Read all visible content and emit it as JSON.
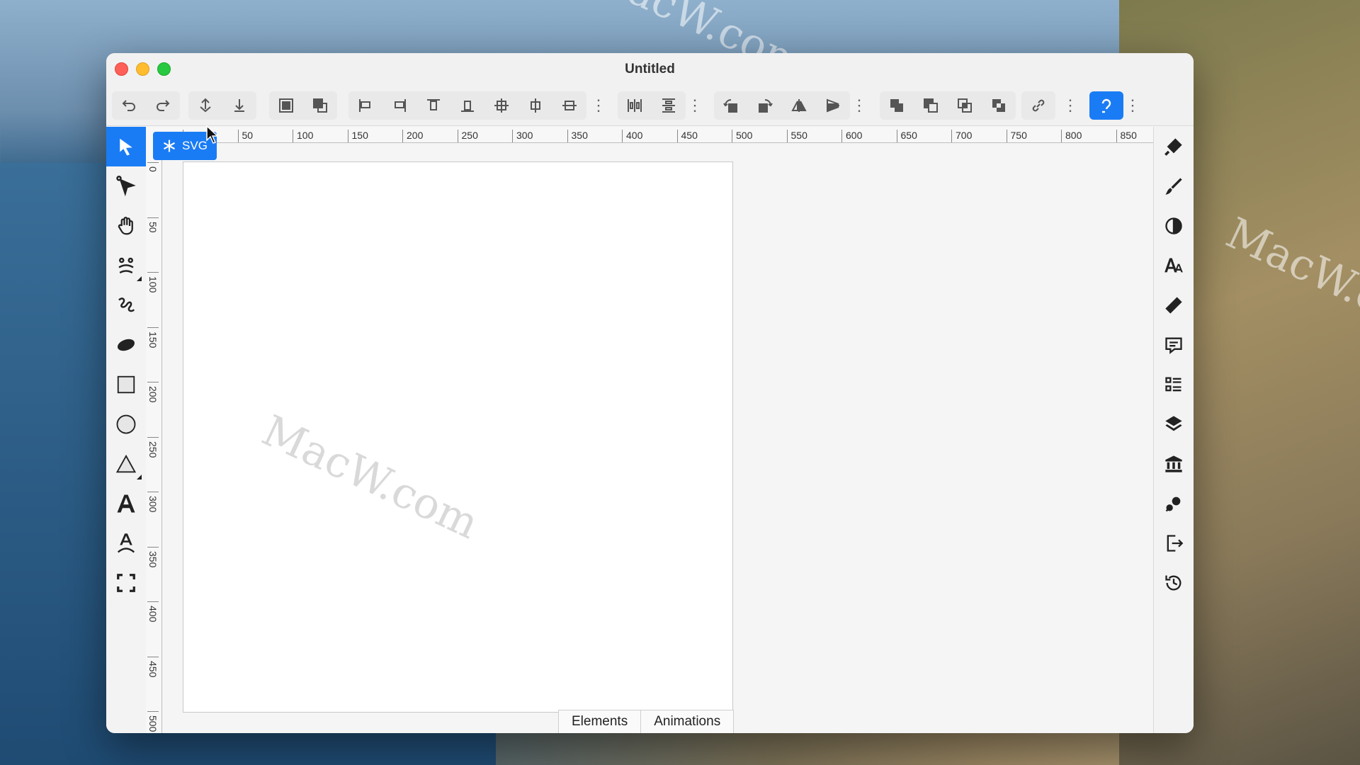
{
  "window": {
    "title": "Untitled"
  },
  "document_badge": {
    "label": "SVG",
    "icon": "asterisk-icon"
  },
  "toolbar": {
    "undo": "undo-icon",
    "redo": "redo-icon",
    "active_color": "#1a7cf5"
  },
  "rulers": {
    "horizontal": [
      "0",
      "50",
      "100",
      "150",
      "200",
      "250",
      "300",
      "350",
      "400",
      "450",
      "500",
      "550",
      "600",
      "650",
      "700",
      "750",
      "800",
      "850"
    ],
    "vertical": [
      "0",
      "50",
      "100",
      "150",
      "200",
      "250",
      "300",
      "350",
      "400",
      "450",
      "500"
    ]
  },
  "left_tools": [
    "select-tool",
    "node-tool",
    "pan-tool",
    "face-tool",
    "freehand-tool",
    "blob-brush-tool",
    "rectangle-tool",
    "circle-tool",
    "triangle-tool",
    "text-tool",
    "text-on-path-tool",
    "fullscreen-tool"
  ],
  "right_tools": [
    "paint-bucket",
    "brush",
    "contrast",
    "typography",
    "ruler",
    "comments",
    "list",
    "layers",
    "library",
    "effects",
    "export",
    "history"
  ],
  "bottom_tabs": [
    {
      "label": "Elements"
    },
    {
      "label": "Animations"
    }
  ],
  "watermark": "MacW.com"
}
